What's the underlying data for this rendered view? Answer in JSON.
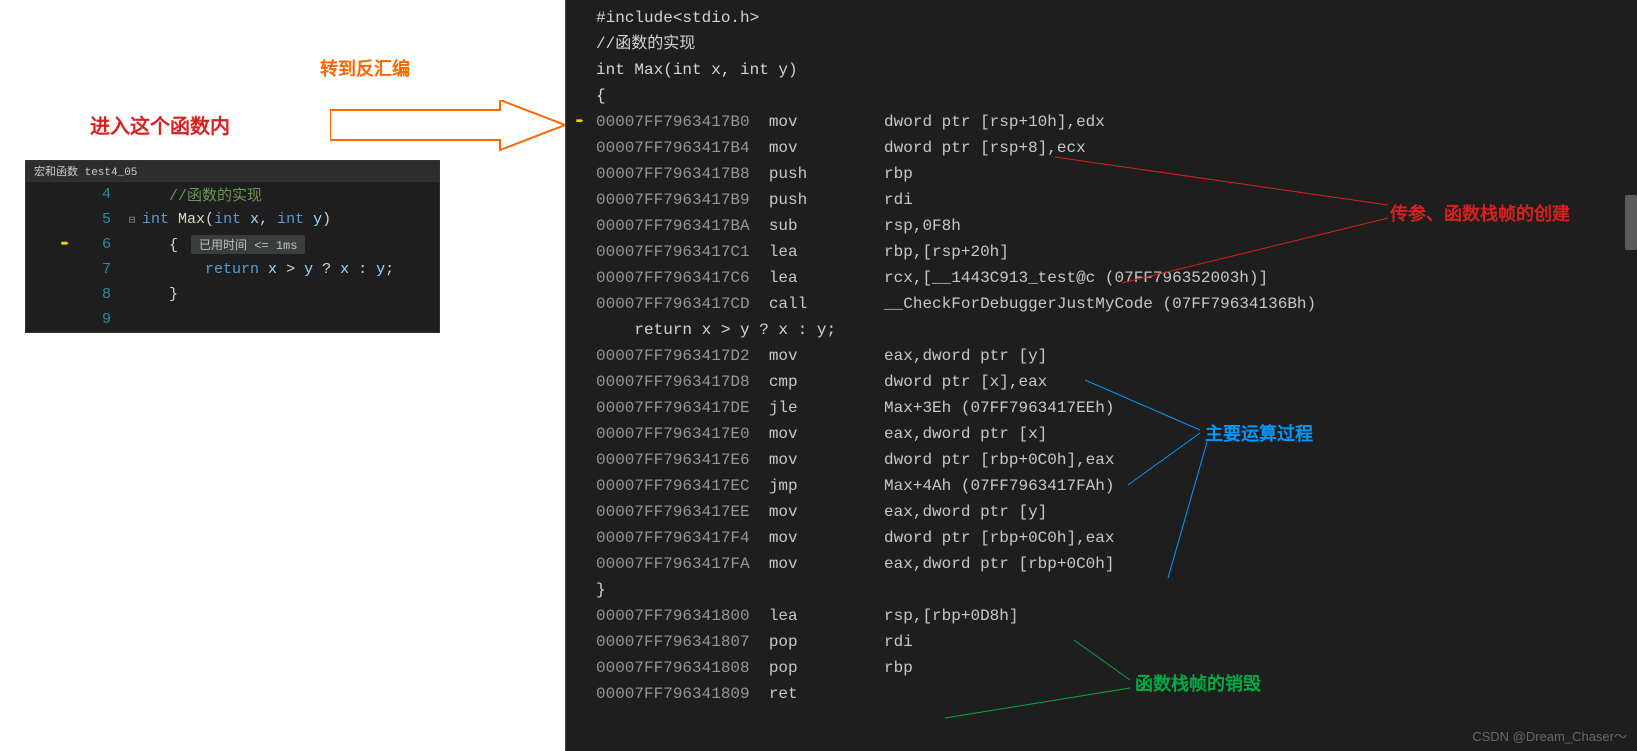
{
  "leftEditor": {
    "headerTab": "宏和函数 test4_05",
    "lines": [
      {
        "num": "4",
        "content_html": "comment:   //函数的实现"
      },
      {
        "num": "5",
        "fold": "⊟",
        "content_html": "keyword:int|punct: |func:Max|punct:(|type:int|punct: |var:x|punct:, |type:int|punct: |var:y|punct:)"
      },
      {
        "num": "6",
        "arrow": true,
        "content_html": "punct:   { |badge:已用时间 <= 1ms"
      },
      {
        "num": "7",
        "content_html": "keyword:       return|punct: |var:x|punct: > |var:y|punct: ? |var:x|punct: : |var:y|punct:;"
      },
      {
        "num": "8",
        "content_html": "punct:   }"
      },
      {
        "num": "9",
        "content_html": ""
      }
    ]
  },
  "annotations": {
    "enterFunc": "进入这个函数内",
    "gotoDisasm": "转到反汇编",
    "paramStack": "传参、函数栈帧的创建",
    "mainCalc": "主要运算过程",
    "stackDestroy": "函数栈帧的销毁",
    "watermark": "CSDN @Dream_Chaser～"
  },
  "asm": {
    "sourceLines": [
      "#include<stdio.h>",
      "//函数的实现",
      "int Max(int x, int y)",
      "{"
    ],
    "block1": [
      {
        "addr": "00007FF7963417B0",
        "instr": "mov",
        "op": "dword ptr [rsp+10h],edx",
        "arrow": true
      },
      {
        "addr": "00007FF7963417B4",
        "instr": "mov",
        "op": "dword ptr [rsp+8],ecx"
      },
      {
        "addr": "00007FF7963417B8",
        "instr": "push",
        "op": "rbp"
      },
      {
        "addr": "00007FF7963417B9",
        "instr": "push",
        "op": "rdi"
      },
      {
        "addr": "00007FF7963417BA",
        "instr": "sub",
        "op": "rsp,0F8h"
      },
      {
        "addr": "00007FF7963417C1",
        "instr": "lea",
        "op": "rbp,[rsp+20h]"
      },
      {
        "addr": "00007FF7963417C6",
        "instr": "lea",
        "op": "rcx,[__1443C913_test@c (07FF796352003h)]"
      },
      {
        "addr": "00007FF7963417CD",
        "instr": "call",
        "op": "__CheckForDebuggerJustMyCode (07FF79634136Bh)"
      }
    ],
    "returnLine": "    return x > y ? x : y;",
    "block2": [
      {
        "addr": "00007FF7963417D2",
        "instr": "mov",
        "op": "eax,dword ptr [y]"
      },
      {
        "addr": "00007FF7963417D8",
        "instr": "cmp",
        "op": "dword ptr [x],eax"
      },
      {
        "addr": "00007FF7963417DE",
        "instr": "jle",
        "op": "Max+3Eh (07FF7963417EEh)"
      },
      {
        "addr": "00007FF7963417E0",
        "instr": "mov",
        "op": "eax,dword ptr [x]"
      },
      {
        "addr": "00007FF7963417E6",
        "instr": "mov",
        "op": "dword ptr [rbp+0C0h],eax"
      },
      {
        "addr": "00007FF7963417EC",
        "instr": "jmp",
        "op": "Max+4Ah (07FF7963417FAh)"
      },
      {
        "addr": "00007FF7963417EE",
        "instr": "mov",
        "op": "eax,dword ptr [y]"
      },
      {
        "addr": "00007FF7963417F4",
        "instr": "mov",
        "op": "dword ptr [rbp+0C0h],eax"
      },
      {
        "addr": "00007FF7963417FA",
        "instr": "mov",
        "op": "eax,dword ptr [rbp+0C0h]"
      }
    ],
    "closeBrace": "}",
    "block3": [
      {
        "addr": "00007FF796341800",
        "instr": "lea",
        "op": "rsp,[rbp+0D8h]"
      },
      {
        "addr": "00007FF796341807",
        "instr": "pop",
        "op": "rdi"
      },
      {
        "addr": "00007FF796341808",
        "instr": "pop",
        "op": "rbp"
      },
      {
        "addr": "00007FF796341809",
        "instr": "ret",
        "op": ""
      }
    ]
  }
}
